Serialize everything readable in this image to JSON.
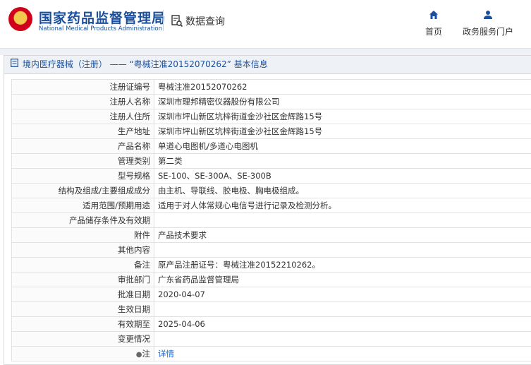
{
  "header": {
    "brand_cn": "国家药品监督管理局",
    "brand_en": "National Medical Products Administration",
    "query_label": "数据查询",
    "nav": [
      {
        "label": "首页",
        "icon": "home-icon"
      },
      {
        "label": "政务服务门户",
        "icon": "user-icon"
      }
    ]
  },
  "panel": {
    "title": "境内医疗器械（注册） —— “粤械注准20152070262” 基本信息"
  },
  "rows": [
    {
      "label": "注册证编号",
      "value": "粤械注准20152070262"
    },
    {
      "label": "注册人名称",
      "value": "深圳市理邦精密仪器股份有限公司"
    },
    {
      "label": "注册人住所",
      "value": "深圳市坪山新区坑梓街道金沙社区金辉路15号"
    },
    {
      "label": "生产地址",
      "value": "深圳市坪山新区坑梓街道金沙社区金辉路15号"
    },
    {
      "label": "产品名称",
      "value": "单道心电图机/多道心电图机"
    },
    {
      "label": "管理类别",
      "value": "第二类"
    },
    {
      "label": "型号规格",
      "value": "SE-100、SE-300A、SE-300B"
    },
    {
      "label": "结构及组成/主要组成成分",
      "value": "由主机、导联线、胶电极、胸电极组成。"
    },
    {
      "label": "适用范围/预期用途",
      "value": "适用于对人体常规心电信号进行记录及检测分析。"
    },
    {
      "label": "产品储存条件及有效期",
      "value": ""
    },
    {
      "label": "附件",
      "value": "产品技术要求"
    },
    {
      "label": "其他内容",
      "value": ""
    },
    {
      "label": "备注",
      "value": "原产品注册证号：粤械注准20152210262。"
    },
    {
      "label": "审批部门",
      "value": "广东省药品监督管理局"
    },
    {
      "label": "批准日期",
      "value": "2020-04-07"
    },
    {
      "label": "生效日期",
      "value": ""
    },
    {
      "label": "有效期至",
      "value": "2025-04-06"
    },
    {
      "label": "变更情况",
      "value": ""
    }
  ],
  "note_row": {
    "label": "注",
    "link": "详情"
  }
}
